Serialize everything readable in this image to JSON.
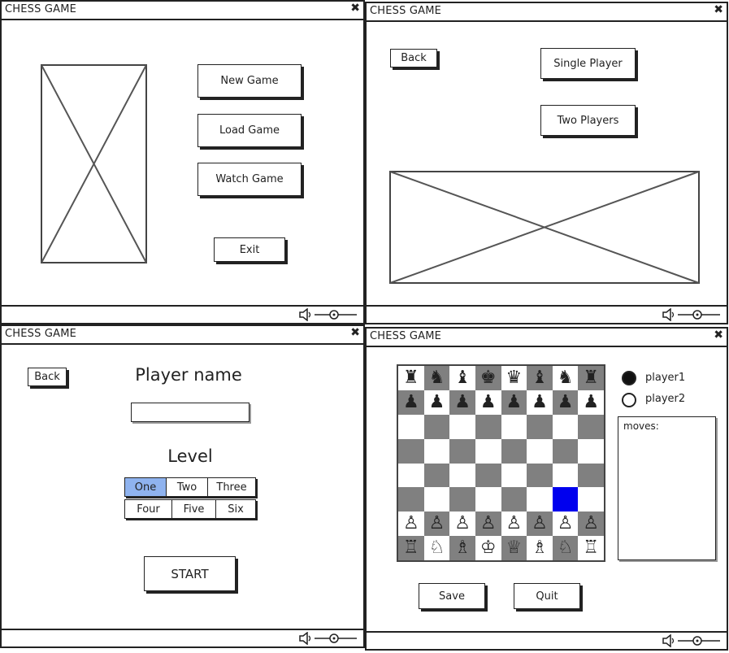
{
  "window_title": "CHESS GAME",
  "close_glyph": "✖",
  "main_menu": {
    "buttons": {
      "new_game": "New Game",
      "load_game": "Load Game",
      "watch_game": "Watch Game",
      "exit": "Exit"
    }
  },
  "mode_select": {
    "back": "Back",
    "buttons": {
      "single": "Single Player",
      "two": "Two Players"
    }
  },
  "setup": {
    "back": "Back",
    "player_name_label": "Player name",
    "player_name_value": "",
    "level_label": "Level",
    "levels_row1": [
      "One",
      "Two",
      "Three"
    ],
    "levels_row2": [
      "Four",
      "Five",
      "Six"
    ],
    "selected_level": "One",
    "start": "START"
  },
  "game": {
    "player1": "player1",
    "player2": "player2",
    "moves_label": "moves:",
    "save": "Save",
    "quit": "Quit",
    "board": [
      [
        "♜",
        "♞",
        "♝",
        "♚",
        "♛",
        "♝",
        "♞",
        "♜"
      ],
      [
        "♟",
        "♟",
        "♟",
        "♟",
        "♟",
        "♟",
        "♟",
        "♟"
      ],
      [
        "",
        "",
        "",
        "",
        "",
        "",
        "",
        ""
      ],
      [
        "",
        "",
        "",
        "",
        "",
        "",
        "",
        ""
      ],
      [
        "",
        "",
        "",
        "",
        "",
        "",
        "",
        ""
      ],
      [
        "",
        "",
        "",
        "",
        "",
        "",
        "",
        ""
      ],
      [
        "♙",
        "♙",
        "♙",
        "♙",
        "♙",
        "♙",
        "♙",
        "♙"
      ],
      [
        "♖",
        "♘",
        "♗",
        "♔",
        "♕",
        "♗",
        "♘",
        "♖"
      ]
    ],
    "highlight_square": "g3",
    "highlight_color": "#0000ee"
  },
  "colors": {
    "dark_square": "#808080",
    "selected_level": "#8fb3ef"
  }
}
